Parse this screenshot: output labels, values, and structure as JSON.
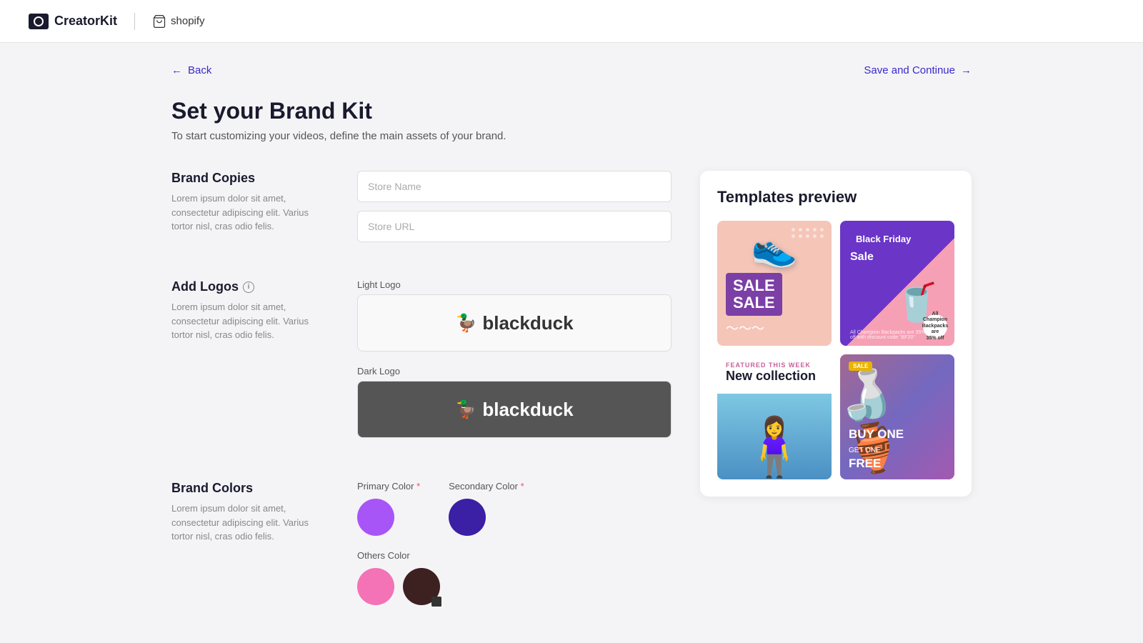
{
  "header": {
    "app_name": "CreatorKit",
    "platform_name": "shopify"
  },
  "nav": {
    "back_label": "Back",
    "save_continue_label": "Save and Continue"
  },
  "page": {
    "title": "Set your Brand Kit",
    "subtitle": "To start customizing your videos, define the main assets of your brand."
  },
  "brand_copies": {
    "section_title": "Brand Copies",
    "section_desc": "Lorem ipsum dolor sit amet, consectetur adipiscing elit. Varius tortor nisl, cras odio felis.",
    "store_name_placeholder": "Store Name",
    "store_url_placeholder": "Store URL"
  },
  "add_logos": {
    "section_title": "Add Logos",
    "section_desc": "Lorem ipsum dolor sit amet, consectetur adipiscing elit. Varius tortor nisl, cras odio felis.",
    "light_logo_label": "Light Logo",
    "dark_logo_label": "Dark Logo",
    "logo_text": "blackduck"
  },
  "brand_colors": {
    "section_title": "Brand Colors",
    "section_desc": "Lorem ipsum dolor sit amet, consectetur adipiscing elit. Varius tortor nisl, cras odio felis.",
    "primary_label": "Primary Color",
    "secondary_label": "Secondary Color",
    "others_label": "Others Color",
    "primary_color": "#a855f7",
    "secondary_color": "#3b1fa5",
    "other_color1": "#f472b6",
    "other_color2": "#3d2020"
  },
  "templates_preview": {
    "title": "Templates preview",
    "templates": [
      {
        "id": "tpl1",
        "name": "Sale Sale",
        "type": "pink-shoe"
      },
      {
        "id": "tpl2",
        "name": "Black Friday Sale",
        "type": "purple-cup"
      },
      {
        "id": "tpl3",
        "name": "New collection",
        "type": "fashion"
      },
      {
        "id": "tpl4",
        "name": "Buy One Get One Free",
        "type": "ceramics"
      }
    ]
  }
}
